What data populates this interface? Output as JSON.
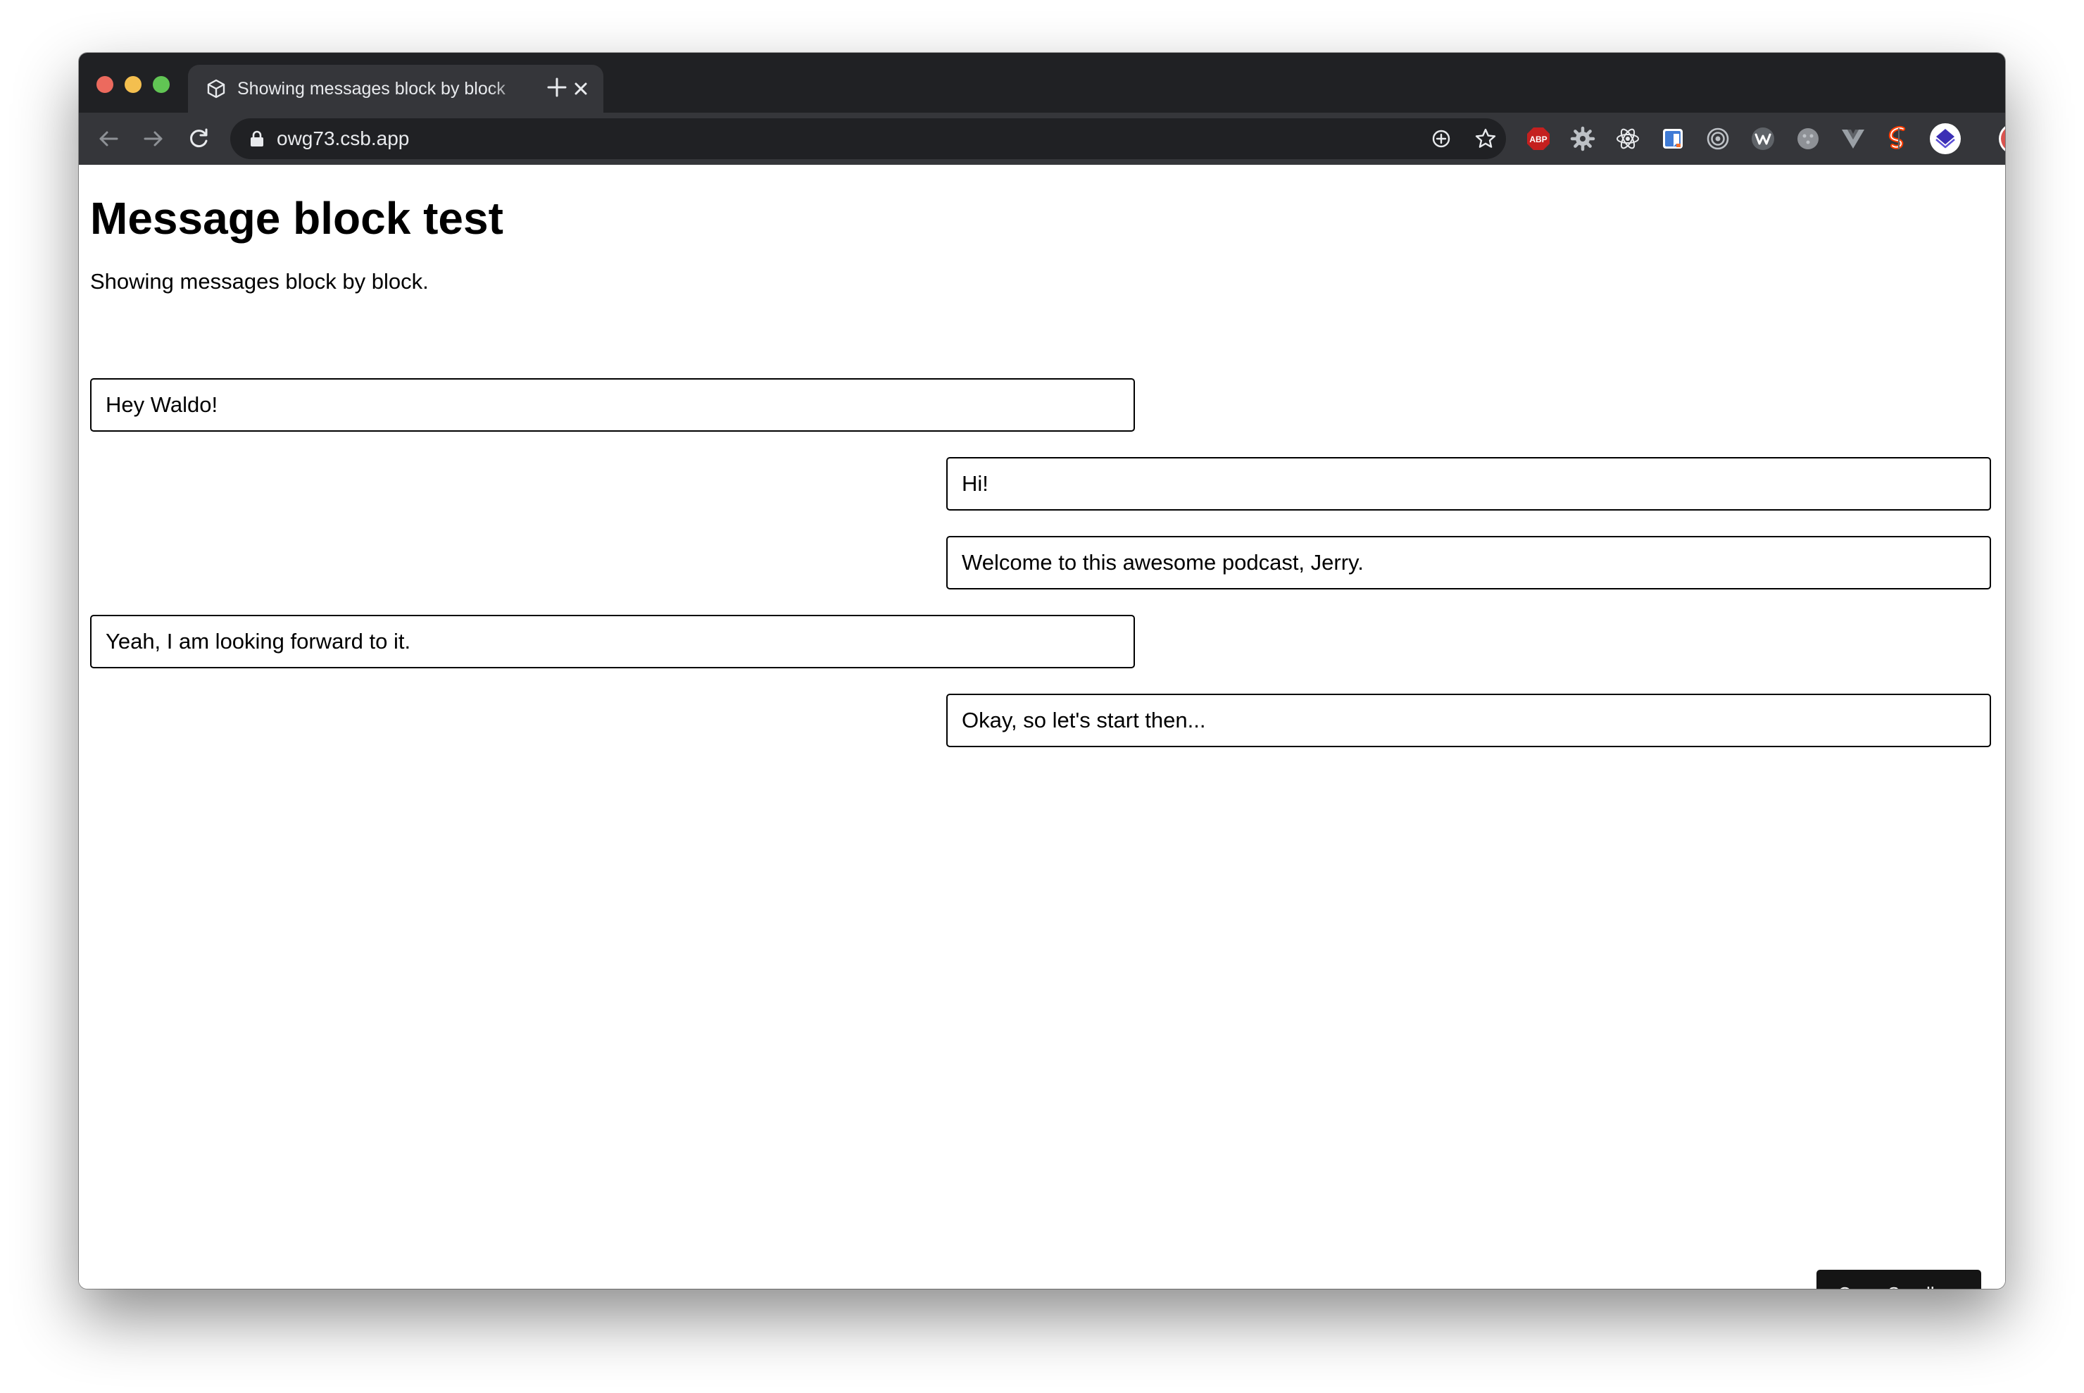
{
  "browser": {
    "tab": {
      "title": "Showing messages block by block",
      "favicon": "codesandbox-cube-icon"
    },
    "address_bar": {
      "url": "owg73.csb.app"
    },
    "extensions": [
      {
        "name": "adblock-plus-icon",
        "label": "ABP",
        "color": "#c4201f"
      },
      {
        "name": "gear-extension-icon"
      },
      {
        "name": "react-devtools-icon"
      },
      {
        "name": "bookmark-extension-icon",
        "color": "#3f7bd5"
      },
      {
        "name": "target-extension-icon"
      },
      {
        "name": "w-extension-icon"
      },
      {
        "name": "circle-extension-icon"
      },
      {
        "name": "vue-devtools-icon"
      },
      {
        "name": "svelte-devtools-icon",
        "color": "#ff3e00"
      },
      {
        "name": "stack-extension-icon",
        "color": "#3b2fb5"
      },
      {
        "name": "profile-avatar"
      },
      {
        "name": "more-menu-icon"
      }
    ]
  },
  "page": {
    "title": "Message block test",
    "subtitle": "Showing messages block by block.",
    "messages": [
      {
        "text": "Hey Waldo!",
        "side": "left"
      },
      {
        "text": "Hi!",
        "side": "right"
      },
      {
        "text": "Welcome to this awesome podcast, Jerry.",
        "side": "right"
      },
      {
        "text": "Yeah, I am looking forward to it.",
        "side": "left"
      },
      {
        "text": "Okay, so let's start then...",
        "side": "right"
      }
    ],
    "open_sandbox_label": "Open Sandbox"
  }
}
